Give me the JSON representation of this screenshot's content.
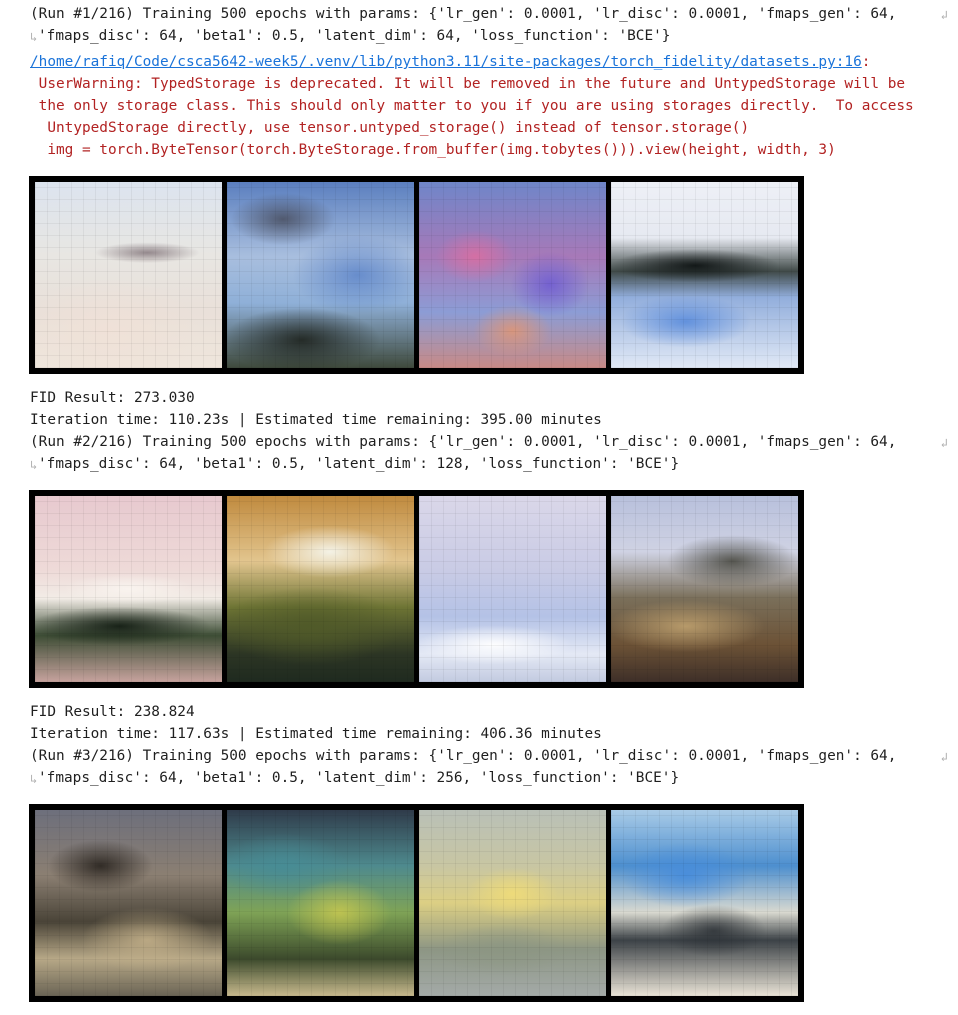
{
  "runs": [
    {
      "header_line1": "(Run #1/216) Training 500 epochs with params: {'lr_gen': 0.0001, 'lr_disc': 0.0001, 'fmaps_gen': 64,",
      "header_line2": "'fmaps_disc': 64, 'beta1': 0.5, 'latent_dim': 64, 'loss_function': 'BCE'}",
      "warning": {
        "path": "/home/rafiq/Code/csca5642-week5/.venv/lib/python3.11/site-packages/torch_fidelity/datasets.py:16",
        "colon": ":",
        "line1": " UserWarning: TypedStorage is deprecated. It will be removed in the future and UntypedStorage will be",
        "line2": " the only storage class. This should only matter to you if you are using storages directly.  To access",
        "line3": "  UntypedStorage directly, use tensor.untyped_storage() instead of tensor.storage()",
        "line4": "  img = torch.ByteTensor(torch.ByteStorage.from_buffer(img.tobytes())).view(height, width, 3)"
      },
      "fid": "FID Result: 273.030",
      "iteration": "Iteration time: 110.23s | Estimated time remaining: 395.00 minutes"
    },
    {
      "header_line1": "(Run #2/216) Training 500 epochs with params: {'lr_gen': 0.0001, 'lr_disc': 0.0001, 'fmaps_gen': 64,",
      "header_line2": "'fmaps_disc': 64, 'beta1': 0.5, 'latent_dim': 128, 'loss_function': 'BCE'}",
      "fid": "FID Result: 238.824",
      "iteration": "Iteration time: 117.63s | Estimated time remaining: 406.36 minutes"
    },
    {
      "header_line1": "(Run #3/216) Training 500 epochs with params: {'lr_gen': 0.0001, 'lr_disc': 0.0001, 'fmaps_gen': 64,",
      "header_line2": "'fmaps_disc': 64, 'beta1': 0.5, 'latent_dim': 256, 'loss_function': 'BCE'}"
    }
  ],
  "wrap_symbol": "↲",
  "continue_symbol": "↳",
  "colors": {
    "warning_text": "#b22222",
    "link": "#1a73d9"
  }
}
